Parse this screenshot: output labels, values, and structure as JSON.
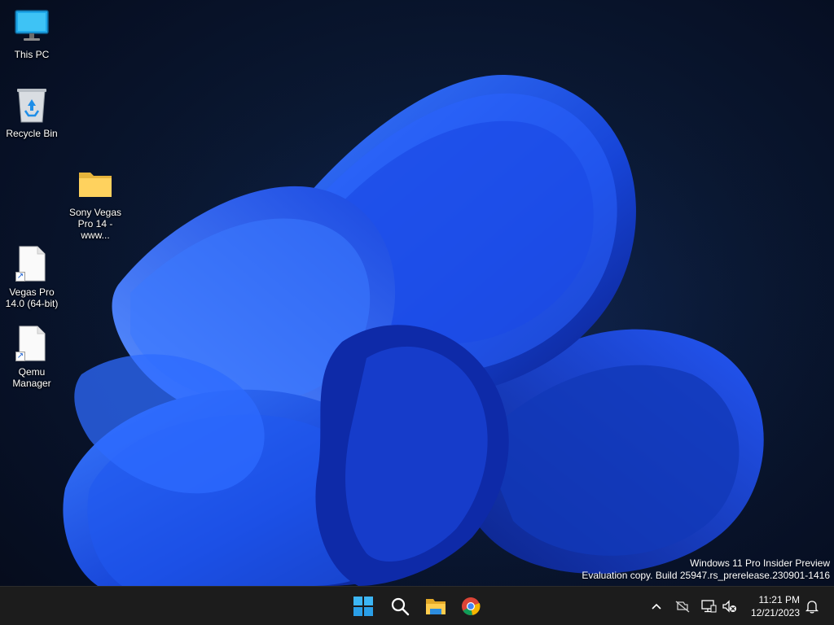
{
  "desktop": {
    "icons": [
      {
        "label": "This PC",
        "icon": "monitor-icon"
      },
      {
        "label": "Recycle Bin",
        "icon": "recycle-bin-icon"
      },
      {
        "label": "Sony Vegas Pro 14 - www...",
        "icon": "folder-icon"
      },
      {
        "label": "Vegas Pro 14.0 (64-bit)",
        "icon": "document-shortcut-icon"
      },
      {
        "label": "Qemu Manager",
        "icon": "document-shortcut-icon"
      }
    ]
  },
  "watermark": {
    "line1": "Windows 11 Pro Insider Preview",
    "line2": "Evaluation copy. Build 25947.rs_prerelease.230901-1416"
  },
  "taskbar": {
    "apps": [
      "start-icon",
      "search-icon",
      "file-explorer-icon",
      "chrome-icon"
    ],
    "tray": [
      "chevron-up-icon",
      "network-off-icon",
      "display-icon",
      "volume-muted-icon",
      "notification-bell-icon"
    ],
    "clock": {
      "time": "11:21 PM",
      "date": "12/21/2023"
    }
  },
  "colors": {
    "accent": "#1f5cff",
    "taskbar": "#1c1c1c"
  }
}
